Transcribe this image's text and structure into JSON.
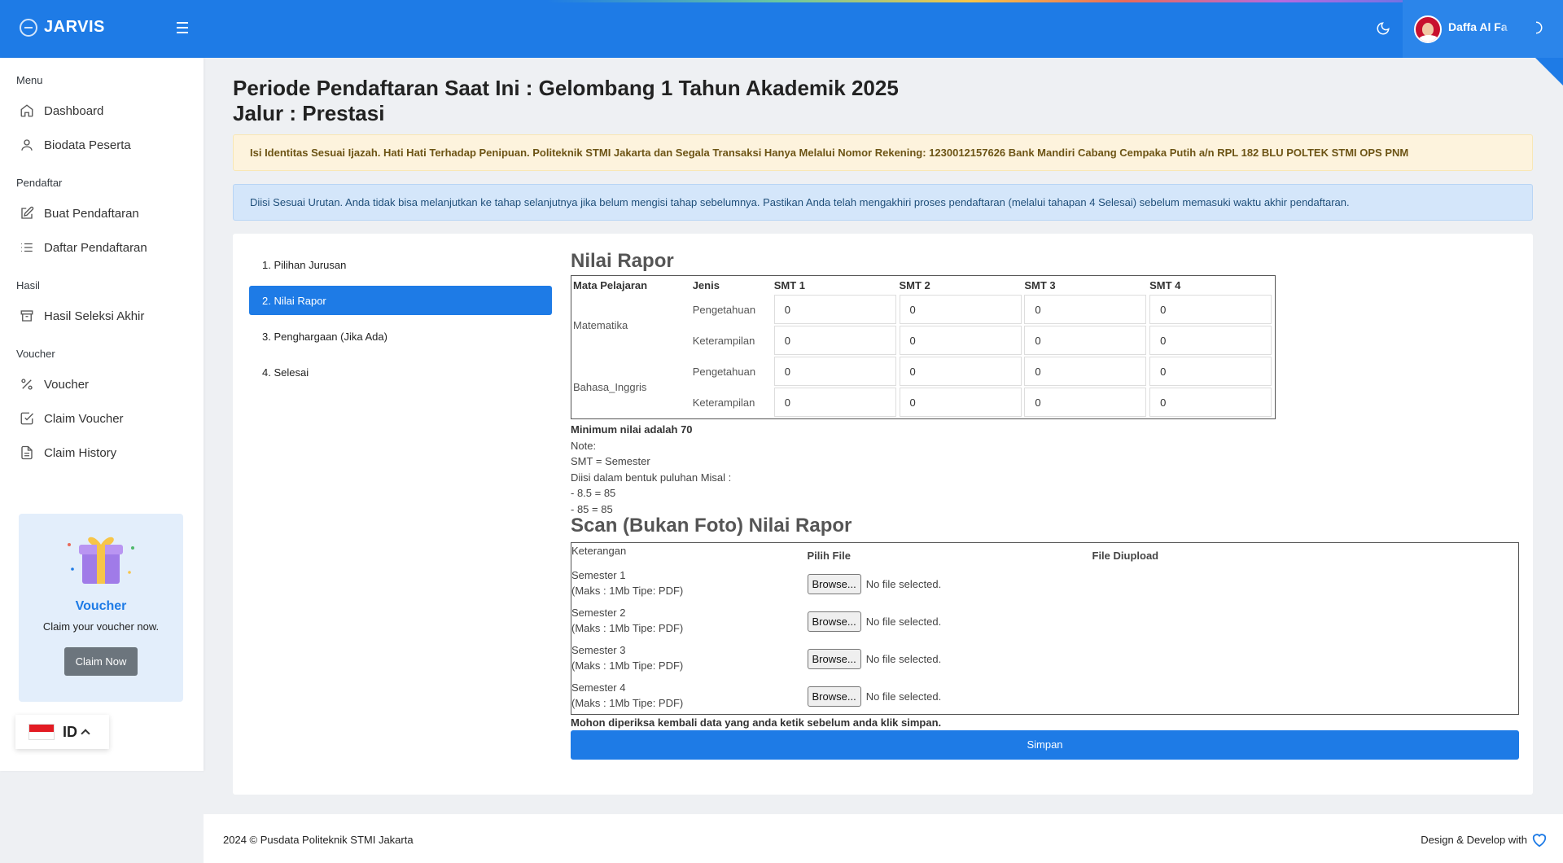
{
  "brand": {
    "name": "JARVIS",
    "icon": "globe-icon"
  },
  "user": {
    "name": "Daffa Al Fa"
  },
  "sidebar": {
    "sections": [
      {
        "heading": "Menu",
        "items": [
          {
            "label": "Dashboard",
            "icon": "home-icon"
          },
          {
            "label": "Biodata Peserta",
            "icon": "user-icon"
          }
        ]
      },
      {
        "heading": "Pendaftar",
        "items": [
          {
            "label": "Buat Pendaftaran",
            "icon": "edit-icon"
          },
          {
            "label": "Daftar Pendaftaran",
            "icon": "list-icon"
          }
        ]
      },
      {
        "heading": "Hasil",
        "items": [
          {
            "label": "Hasil Seleksi Akhir",
            "icon": "archive-icon"
          }
        ]
      },
      {
        "heading": "Voucher",
        "items": [
          {
            "label": "Voucher",
            "icon": "percent-icon"
          },
          {
            "label": "Claim Voucher",
            "icon": "check-square-icon"
          },
          {
            "label": "Claim History",
            "icon": "file-icon"
          }
        ]
      }
    ],
    "voucher_card": {
      "title": "Voucher",
      "subtitle": "Claim your voucher now.",
      "button": "Claim Now"
    },
    "language": {
      "code": "ID"
    }
  },
  "page": {
    "title_line1": "Periode Pendaftaran Saat Ini : Gelombang 1 Tahun Akademik 2025",
    "title_line2": "Jalur : Prestasi",
    "warning": "Isi Identitas Sesuai Ijazah. Hati Hati Terhadap Penipuan. Politeknik STMI Jakarta dan Segala Transaksi Hanya Melalui Nomor Rekening: 1230012157626 Bank Mandiri Cabang Cempaka Putih a/n RPL 182 BLU POLTEK STMI OPS PNM",
    "info": "Diisi Sesuai Urutan. Anda tidak bisa melanjutkan ke tahap selanjutnya jika belum mengisi tahap sebelumnya. Pastikan Anda telah mengakhiri proses pendaftaran (melalui tahapan 4 Selesai) sebelum memasuki waktu akhir pendaftaran."
  },
  "steps": [
    "1. Pilihan Jurusan",
    "2. Nilai Rapor",
    "3. Penghargaan (Jika Ada)",
    "4. Selesai"
  ],
  "active_step": 1,
  "rapor": {
    "title": "Nilai Rapor",
    "headers": {
      "subject": "Mata Pelajaran",
      "type": "Jenis",
      "smt1": "SMT 1",
      "smt2": "SMT 2",
      "smt3": "SMT 3",
      "smt4": "SMT 4"
    },
    "subjects": [
      {
        "name": "Matematika",
        "rows": [
          {
            "type": "Pengetahuan",
            "values": [
              "0",
              "0",
              "0",
              "0"
            ]
          },
          {
            "type": "Keterampilan",
            "values": [
              "0",
              "0",
              "0",
              "0"
            ]
          }
        ]
      },
      {
        "name": "Bahasa_Inggris",
        "rows": [
          {
            "type": "Pengetahuan",
            "values": [
              "0",
              "0",
              "0",
              "0"
            ]
          },
          {
            "type": "Keterampilan",
            "values": [
              "0",
              "0",
              "0",
              "0"
            ]
          }
        ]
      }
    ],
    "notes": {
      "minimum": "Minimum nilai adalah 70",
      "note": "Note:",
      "smt": "SMT = Semester",
      "example": "Diisi dalam bentuk puluhan Misal :",
      "ex1": "- 8.5 = 85",
      "ex2": "- 85 = 85"
    }
  },
  "scan": {
    "title": "Scan (Bukan Foto) Nilai Rapor",
    "headers": {
      "desc": "Keterangan",
      "file": "Pilih File",
      "uploaded": "File Diupload"
    },
    "rows": [
      {
        "semester": "Semester 1",
        "limit": "(Maks : 1Mb Tipe: PDF)"
      },
      {
        "semester": "Semester 2",
        "limit": "(Maks : 1Mb Tipe: PDF)"
      },
      {
        "semester": "Semester 3",
        "limit": "(Maks : 1Mb Tipe: PDF)"
      },
      {
        "semester": "Semester 4",
        "limit": "(Maks : 1Mb Tipe: PDF)"
      }
    ],
    "browse_label": "Browse...",
    "no_file": "No file selected."
  },
  "check_note": "Mohon diperiksa kembali data yang anda ketik sebelum anda klik simpan.",
  "save_label": "Simpan",
  "footer": {
    "left": "2024 © Pusdata Politeknik STMI Jakarta",
    "right": "Design & Develop with"
  }
}
